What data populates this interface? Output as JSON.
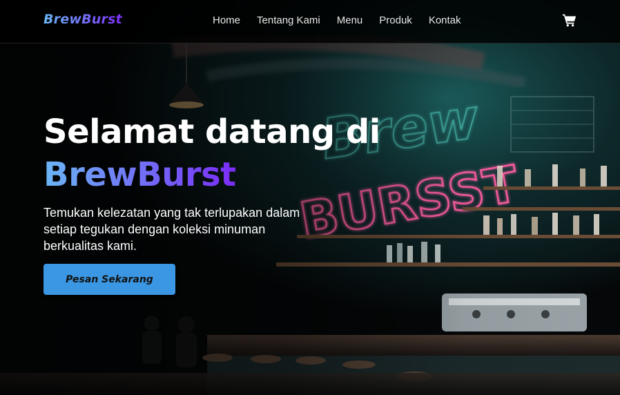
{
  "brand": {
    "logo_text": "BrewBurst"
  },
  "nav": {
    "items": [
      {
        "label": "Home"
      },
      {
        "label": "Tentang Kami"
      },
      {
        "label": "Menu"
      },
      {
        "label": "Produk"
      },
      {
        "label": "Kontak"
      }
    ],
    "cart_icon": "shopping-cart-icon"
  },
  "hero": {
    "title_line1": "Selamat datang di",
    "title_brand": "BrewBurst",
    "subtitle": "Temukan kelezatan yang tak terlupakan dalam setiap tegukan dengan koleksi minuman berkualitas kami.",
    "cta_label": "Pesan Sekarang"
  },
  "background": {
    "neon_sign_text": "Brew BURSST"
  },
  "colors": {
    "accent_blue": "#3b97e3",
    "gradient_start": "#6ab6f5",
    "gradient_end": "#7a2cf6",
    "neon_pink": "#ff5fa2",
    "neon_teal": "#2fd3c6",
    "navbar_bg": "#000000"
  }
}
